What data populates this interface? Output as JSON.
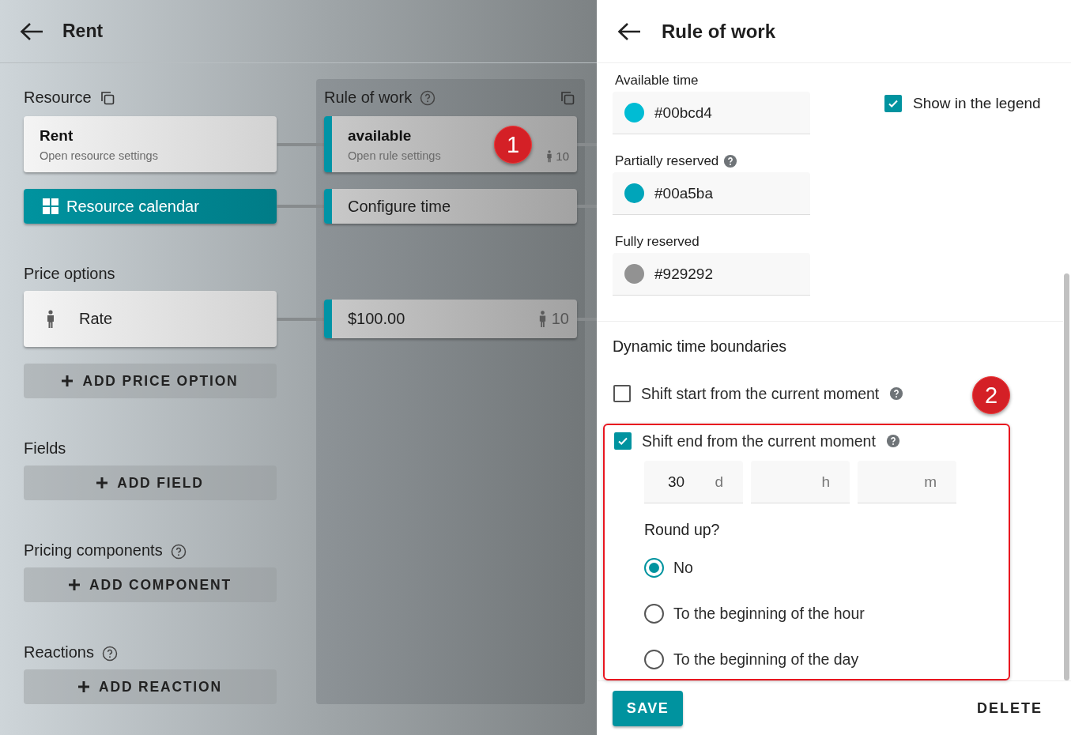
{
  "background_page": {
    "title": "Rent",
    "resource": {
      "heading": "Resource",
      "card_title": "Rent",
      "card_subtitle": "Open resource settings",
      "calendar_button": "Resource calendar"
    },
    "price_options": {
      "heading": "Price options",
      "items": [
        {
          "label": "Rate"
        }
      ],
      "add_button": "ADD PRICE OPTION"
    },
    "sections": [
      {
        "heading": "Fields",
        "help": false,
        "add_button": "ADD FIELD"
      },
      {
        "heading": "Pricing components",
        "help": true,
        "add_button": "ADD COMPONENT"
      },
      {
        "heading": "Reactions",
        "help": true,
        "add_button": "ADD REACTION"
      }
    ],
    "rule_column": {
      "heading": "Rule of work",
      "cards": [
        {
          "kind": "rule",
          "title": "available",
          "subtitle": "Open rule settings",
          "capacity": "10",
          "marker": "1"
        },
        {
          "kind": "action",
          "title": "Configure time"
        },
        {
          "kind": "price",
          "title": "$100.00",
          "capacity": "10"
        }
      ]
    }
  },
  "panel": {
    "title": "Rule of work",
    "colors": [
      {
        "label": "Available time",
        "help": false,
        "value": "#00bcd4",
        "color": "#00bcd4"
      },
      {
        "label": "Partially reserved",
        "help": true,
        "value": "#00a5ba",
        "color": "#00a5ba"
      },
      {
        "label": "Fully reserved",
        "help": false,
        "value": "#929292",
        "color": "#929292"
      }
    ],
    "legend_checkbox": {
      "label": "Show in the legend",
      "checked": true
    },
    "dynamic": {
      "heading": "Dynamic time boundaries",
      "options": [
        {
          "label": "Shift start from the current moment",
          "checked": false,
          "help": true
        },
        {
          "label": "Shift end from the current moment",
          "checked": true,
          "help": true,
          "marker": "2",
          "duration": [
            {
              "value": "30",
              "unit": "d"
            },
            {
              "unit": "h"
            },
            {
              "unit": "m"
            }
          ],
          "round_up": {
            "label": "Round up?",
            "options": [
              {
                "label": "No",
                "selected": true
              },
              {
                "label": "To the beginning of the hour",
                "selected": false
              },
              {
                "label": "To the beginning of the day",
                "selected": false
              }
            ]
          }
        }
      ]
    }
  },
  "footer": {
    "save": "SAVE",
    "delete": "DELETE"
  }
}
